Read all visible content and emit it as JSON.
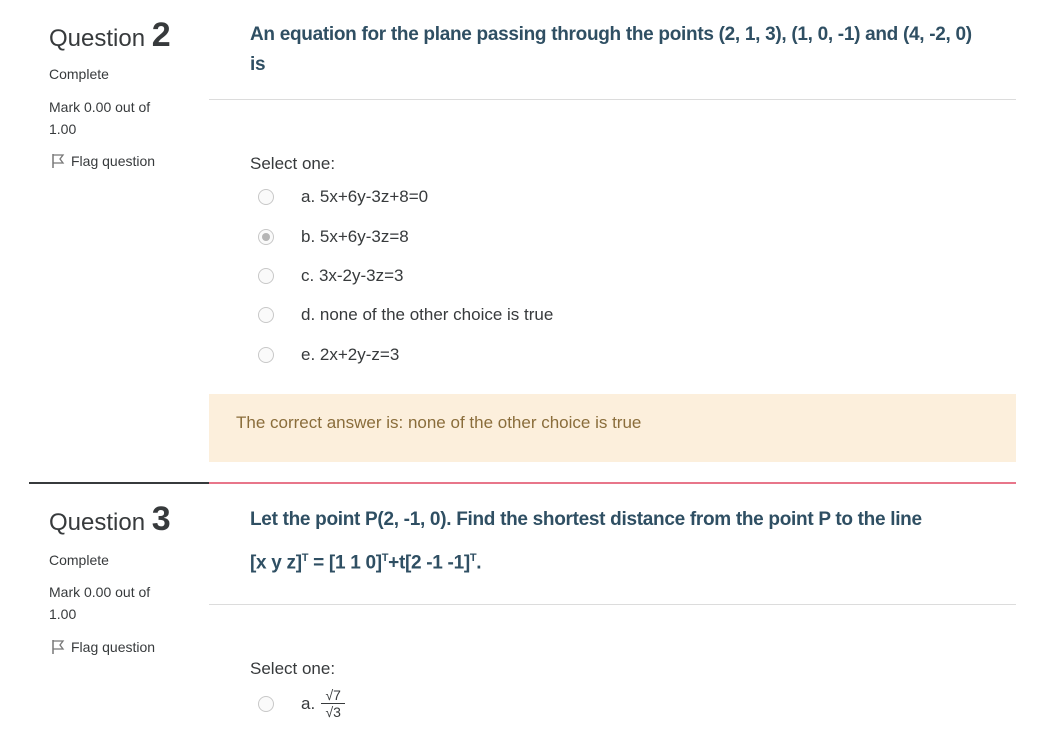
{
  "questions": [
    {
      "title_word": "Question",
      "number": "2",
      "state": "Complete",
      "mark": "Mark 0.00 out of 1.00",
      "flag_label": "Flag question",
      "text": "An equation for the plane passing through the points (2, 1, 3), (1, 0, -1) and (4, -2, 0) is",
      "select_label": "Select one:",
      "options": [
        {
          "label": "a. 5x+6y-3z+8=0",
          "checked": false
        },
        {
          "label": "b. 5x+6y-3z=8",
          "checked": true
        },
        {
          "label": "c. 3x-2y-3z=3",
          "checked": false
        },
        {
          "label": "d. none of the other choice is true",
          "checked": false
        },
        {
          "label": "e. 2x+2y-z=3",
          "checked": false
        }
      ],
      "feedback": "The correct answer is: none of the other choice is true"
    },
    {
      "title_word": "Question",
      "number": "3",
      "state": "Complete",
      "mark": "Mark 0.00 out of 1.00",
      "flag_label": "Flag question",
      "text_line1": "Let the point P(2, -1, 0). Find the shortest distance from the point P to the line",
      "text_line2_a": "[x y z]",
      "text_sup1": "T",
      "text_line2_b": " = [1 1 0]",
      "text_sup2": "T",
      "text_line2_c": "+t[2 -1 -1]",
      "text_sup3": "T",
      "text_line2_d": ".",
      "select_label": "Select one:",
      "options": [
        {
          "letter": "a.",
          "numerator": "√7",
          "denominator": "√3",
          "checked": false
        }
      ]
    }
  ],
  "colors": {
    "question_text": "#2f4f63",
    "feedback_bg": "#fcefdc",
    "feedback_text": "#8a6d3b",
    "active_separator": "#e8768a"
  }
}
